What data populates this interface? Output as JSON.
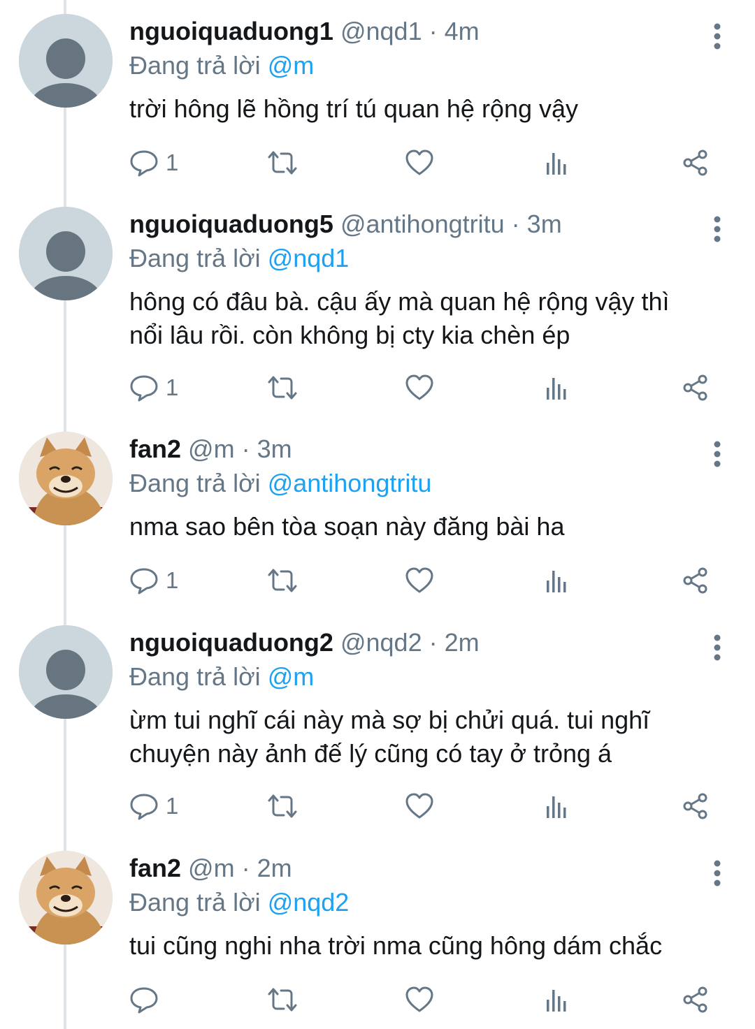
{
  "colors": {
    "link": "#1da1f2",
    "muted": "#657786",
    "text": "#14171a",
    "line": "#e1e4e7"
  },
  "tweets": [
    {
      "name": "nguoiquaduong1",
      "handle": "@nqd1",
      "time": "4m",
      "reply_prefix": "Đang trả lời ",
      "reply_to": "@m",
      "text": "trời hông lẽ hồng trí tú quan hệ rộng vậy",
      "reply_count": "1",
      "avatar": "default-avatar-icon"
    },
    {
      "name": "nguoiquaduong5",
      "handle": "@antihongtritu",
      "time": "3m",
      "reply_prefix": "Đang trả lời ",
      "reply_to": "@nqd1",
      "text": "hông có đâu bà. cậu ấy mà quan hệ rộng vậy thì\nnổi lâu rồi. còn không bị cty kia chèn ép",
      "reply_count": "1",
      "avatar": "default-avatar-icon"
    },
    {
      "name": "fan2",
      "handle": "@m",
      "time": "3m",
      "reply_prefix": "Đang trả lời ",
      "reply_to": "@antihongtritu",
      "text": "nma sao bên tòa soạn này đăng bài ha",
      "reply_count": "1",
      "avatar": "dog-avatar"
    },
    {
      "name": "nguoiquaduong2",
      "handle": "@nqd2",
      "time": "2m",
      "reply_prefix": "Đang trả lời ",
      "reply_to": "@m",
      "text": "ừm tui nghĩ cái này mà sợ bị chửi quá. tui nghĩ\nchuyện này ảnh đế lý cũng có tay ở trỏng á",
      "reply_count": "1",
      "avatar": "default-avatar-icon"
    },
    {
      "name": "fan2",
      "handle": "@m",
      "time": "2m",
      "reply_prefix": "Đang trả lời ",
      "reply_to": "@nqd2",
      "text": "tui cũng nghi nha trời nma cũng hông dám chắc",
      "reply_count": "",
      "avatar": "dog-avatar"
    }
  ],
  "icons": [
    "reply-icon",
    "retweet-icon",
    "like-icon",
    "analytics-icon",
    "share-icon",
    "more-options-icon"
  ]
}
